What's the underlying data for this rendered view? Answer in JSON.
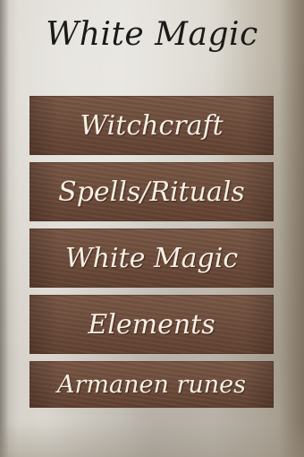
{
  "app": {
    "title": "White Magic"
  },
  "menu": {
    "items": [
      {
        "label": "Witchcraft"
      },
      {
        "label": "Spells/Rituals"
      },
      {
        "label": "White Magic"
      },
      {
        "label": "Elements"
      },
      {
        "label": "Armanen runes"
      }
    ]
  },
  "colors": {
    "button_wood": "#6f4b38",
    "button_text": "#f6efe4",
    "title_text": "#1c1a18",
    "paper": "#e3e0da"
  }
}
